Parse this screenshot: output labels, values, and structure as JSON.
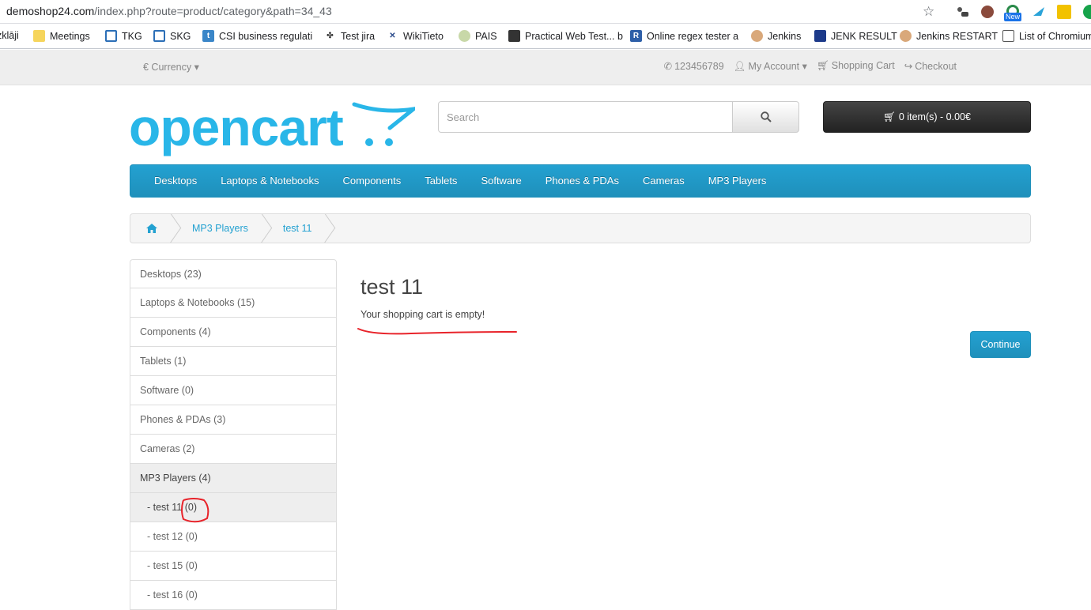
{
  "browser": {
    "url_host": "demoshop24.com",
    "url_path": "/index.php?route=product/category&path=34_43",
    "ext_badge": "New",
    "bookmarks": [
      {
        "label": "zklāji",
        "icon": "page-icon"
      },
      {
        "label": "Meetings",
        "icon": "folder-icon"
      },
      {
        "label": "TKG",
        "icon": "board-icon"
      },
      {
        "label": "SKG",
        "icon": "board-icon"
      },
      {
        "label": "CSI business regulati",
        "icon": "t-icon"
      },
      {
        "label": "Test jira",
        "icon": "jira-icon"
      },
      {
        "label": "WikiTieto",
        "icon": "wiki-icon"
      },
      {
        "label": "PAIS",
        "icon": "cube-icon"
      },
      {
        "label": "Practical Web Test... b",
        "icon": "book-icon"
      },
      {
        "label": "Online regex tester a",
        "icon": "r-icon"
      },
      {
        "label": "Jenkins",
        "icon": "jenkins-icon"
      },
      {
        "label": "JENK RESULT",
        "icon": "jenk-icon"
      },
      {
        "label": "Jenkins RESTART",
        "icon": "jenkins-icon"
      },
      {
        "label": "List of Chromium",
        "icon": "page-icon"
      }
    ]
  },
  "topbar": {
    "currency": "€ Currency ▾",
    "phone": "123456789",
    "account": "My Account ▾",
    "cart": "Shopping Cart",
    "checkout": "Checkout"
  },
  "header": {
    "logo_text": "opencart",
    "search_placeholder": "Search",
    "cart_button": "0 item(s) - 0.00€"
  },
  "menu": [
    "Desktops",
    "Laptops & Notebooks",
    "Components",
    "Tablets",
    "Software",
    "Phones & PDAs",
    "Cameras",
    "MP3 Players"
  ],
  "breadcrumb": [
    "MP3 Players",
    "test 11"
  ],
  "sidebar": [
    {
      "label": "Desktops (23)",
      "active": false,
      "sub": false
    },
    {
      "label": "Laptops & Notebooks (15)",
      "active": false,
      "sub": false
    },
    {
      "label": "Components (4)",
      "active": false,
      "sub": false
    },
    {
      "label": "Tablets (1)",
      "active": false,
      "sub": false
    },
    {
      "label": "Software (0)",
      "active": false,
      "sub": false
    },
    {
      "label": "Phones & PDAs (3)",
      "active": false,
      "sub": false
    },
    {
      "label": "Cameras (2)",
      "active": false,
      "sub": false
    },
    {
      "label": "MP3 Players (4)",
      "active": true,
      "sub": false
    },
    {
      "label": "- test 11 (0)",
      "active": true,
      "sub": true
    },
    {
      "label": "- test 12 (0)",
      "active": false,
      "sub": true
    },
    {
      "label": "- test 15 (0)",
      "active": false,
      "sub": true
    },
    {
      "label": "- test 16 (0)",
      "active": false,
      "sub": true
    }
  ],
  "content": {
    "title": "test 11",
    "message": "Your shopping cart is empty!",
    "continue": "Continue"
  },
  "colors": {
    "accent": "#23a1d1",
    "annotation": "#e8232a"
  }
}
